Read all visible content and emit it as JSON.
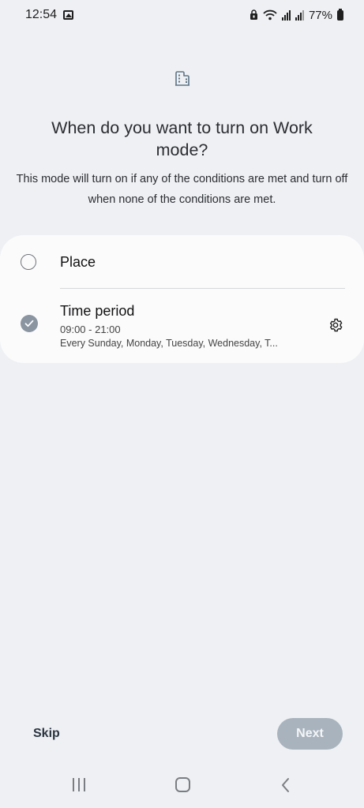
{
  "status_bar": {
    "time": "12:54",
    "battery": "77%"
  },
  "header": {
    "icon": "building-icon",
    "title": "When do you want to turn on Work mode?",
    "description": "This mode will turn on if any of the conditions are met and turn off when none of the conditions are met."
  },
  "conditions": {
    "place": {
      "label": "Place",
      "checked": false
    },
    "time_period": {
      "label": "Time period",
      "range": "09:00 - 21:00",
      "days": "Every Sunday, Monday, Tuesday, Wednesday, T...",
      "checked": true
    }
  },
  "footer": {
    "skip_label": "Skip",
    "next_label": "Next"
  },
  "colors": {
    "background": "#eef0f3",
    "card": "#fbfbfc",
    "check": "#8a95a1",
    "next_button": "#a9b3bd"
  }
}
